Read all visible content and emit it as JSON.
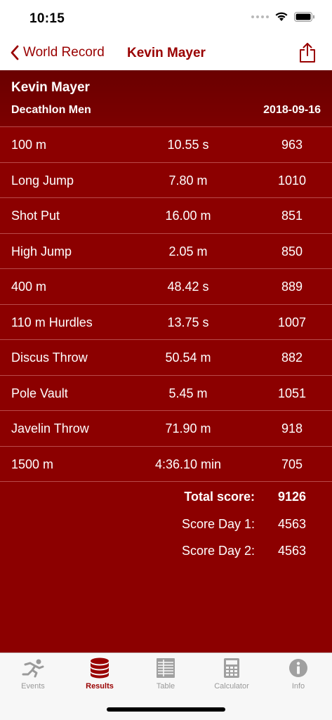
{
  "status": {
    "time": "10:15"
  },
  "nav": {
    "back_label": "World Record",
    "title": "Kevin Mayer"
  },
  "header": {
    "athlete": "Kevin Mayer",
    "event": "Decathlon Men",
    "date": "2018-09-16"
  },
  "results": [
    {
      "event": "100 m",
      "performance": "10.55 s",
      "points": "963"
    },
    {
      "event": "Long Jump",
      "performance": "7.80 m",
      "points": "1010"
    },
    {
      "event": "Shot Put",
      "performance": "16.00 m",
      "points": "851"
    },
    {
      "event": "High Jump",
      "performance": "2.05 m",
      "points": "850"
    },
    {
      "event": "400 m",
      "performance": "48.42 s",
      "points": "889"
    },
    {
      "event": "110 m Hurdles",
      "performance": "13.75 s",
      "points": "1007"
    },
    {
      "event": "Discus Throw",
      "performance": "50.54 m",
      "points": "882"
    },
    {
      "event": "Pole Vault",
      "performance": "5.45 m",
      "points": "1051"
    },
    {
      "event": "Javelin Throw",
      "performance": "71.90 m",
      "points": "918"
    },
    {
      "event": "1500 m",
      "performance": "4:36.10 min",
      "points": "705"
    }
  ],
  "scores": {
    "total_label": "Total score:",
    "total_value": "9126",
    "day1_label": "Score Day 1:",
    "day1_value": "4563",
    "day2_label": "Score Day 2:",
    "day2_value": "4563"
  },
  "tabs": [
    {
      "label": "Events",
      "icon": "runner-icon",
      "active": false
    },
    {
      "label": "Results",
      "icon": "database-icon",
      "active": true
    },
    {
      "label": "Table",
      "icon": "table-icon",
      "active": false
    },
    {
      "label": "Calculator",
      "icon": "calculator-icon",
      "active": false
    },
    {
      "label": "Info",
      "icon": "info-icon",
      "active": false
    }
  ],
  "colors": {
    "accent": "#990000",
    "background": "#8c0000",
    "header": "#6a0000",
    "divider": "#b94a4a",
    "tab_inactive": "#999999"
  }
}
